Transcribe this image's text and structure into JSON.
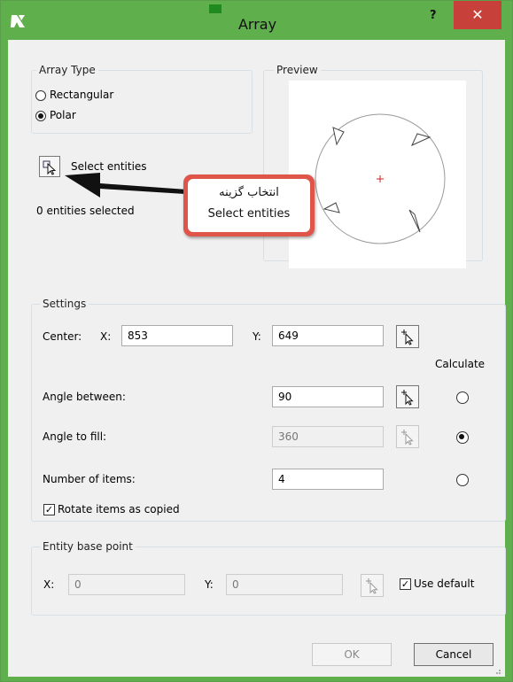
{
  "window": {
    "title": "Array",
    "help_label": "?",
    "close_label": "✕"
  },
  "array_type": {
    "group_label": "Array Type",
    "options": [
      {
        "label": "Rectangular",
        "checked": false
      },
      {
        "label": "Polar",
        "checked": true
      }
    ]
  },
  "preview": {
    "group_label": "Preview"
  },
  "selection": {
    "button_label": "Select entities",
    "status_text": "0 entities selected"
  },
  "callout": {
    "line1": "انتخاب گزینه",
    "line2": "Select entities"
  },
  "settings": {
    "group_label": "Settings",
    "center_label": "Center:",
    "x_label": "X:",
    "center_x": "853",
    "y_label": "Y:",
    "center_y": "649",
    "calculate_label": "Calculate",
    "angle_between_label": "Angle between:",
    "angle_between_value": "90",
    "angle_to_fill_label": "Angle to fill:",
    "angle_to_fill_value": "360",
    "number_of_items_label": "Number of items:",
    "number_of_items_value": "4",
    "calculate_selected": "angle_to_fill",
    "rotate_label": "Rotate items as copied",
    "rotate_checked": true
  },
  "base_point": {
    "group_label": "Entity base point",
    "x_label": "X:",
    "x_value": "0",
    "y_label": "Y:",
    "y_value": "0",
    "use_default_label": "Use default",
    "use_default_checked": true
  },
  "buttons": {
    "ok_label": "OK",
    "cancel_label": "Cancel"
  },
  "colors": {
    "title_bar": "#5fb04c",
    "close_button": "#c7403a",
    "callout_border": "#e0554a",
    "center_marker": "#cc2222"
  }
}
